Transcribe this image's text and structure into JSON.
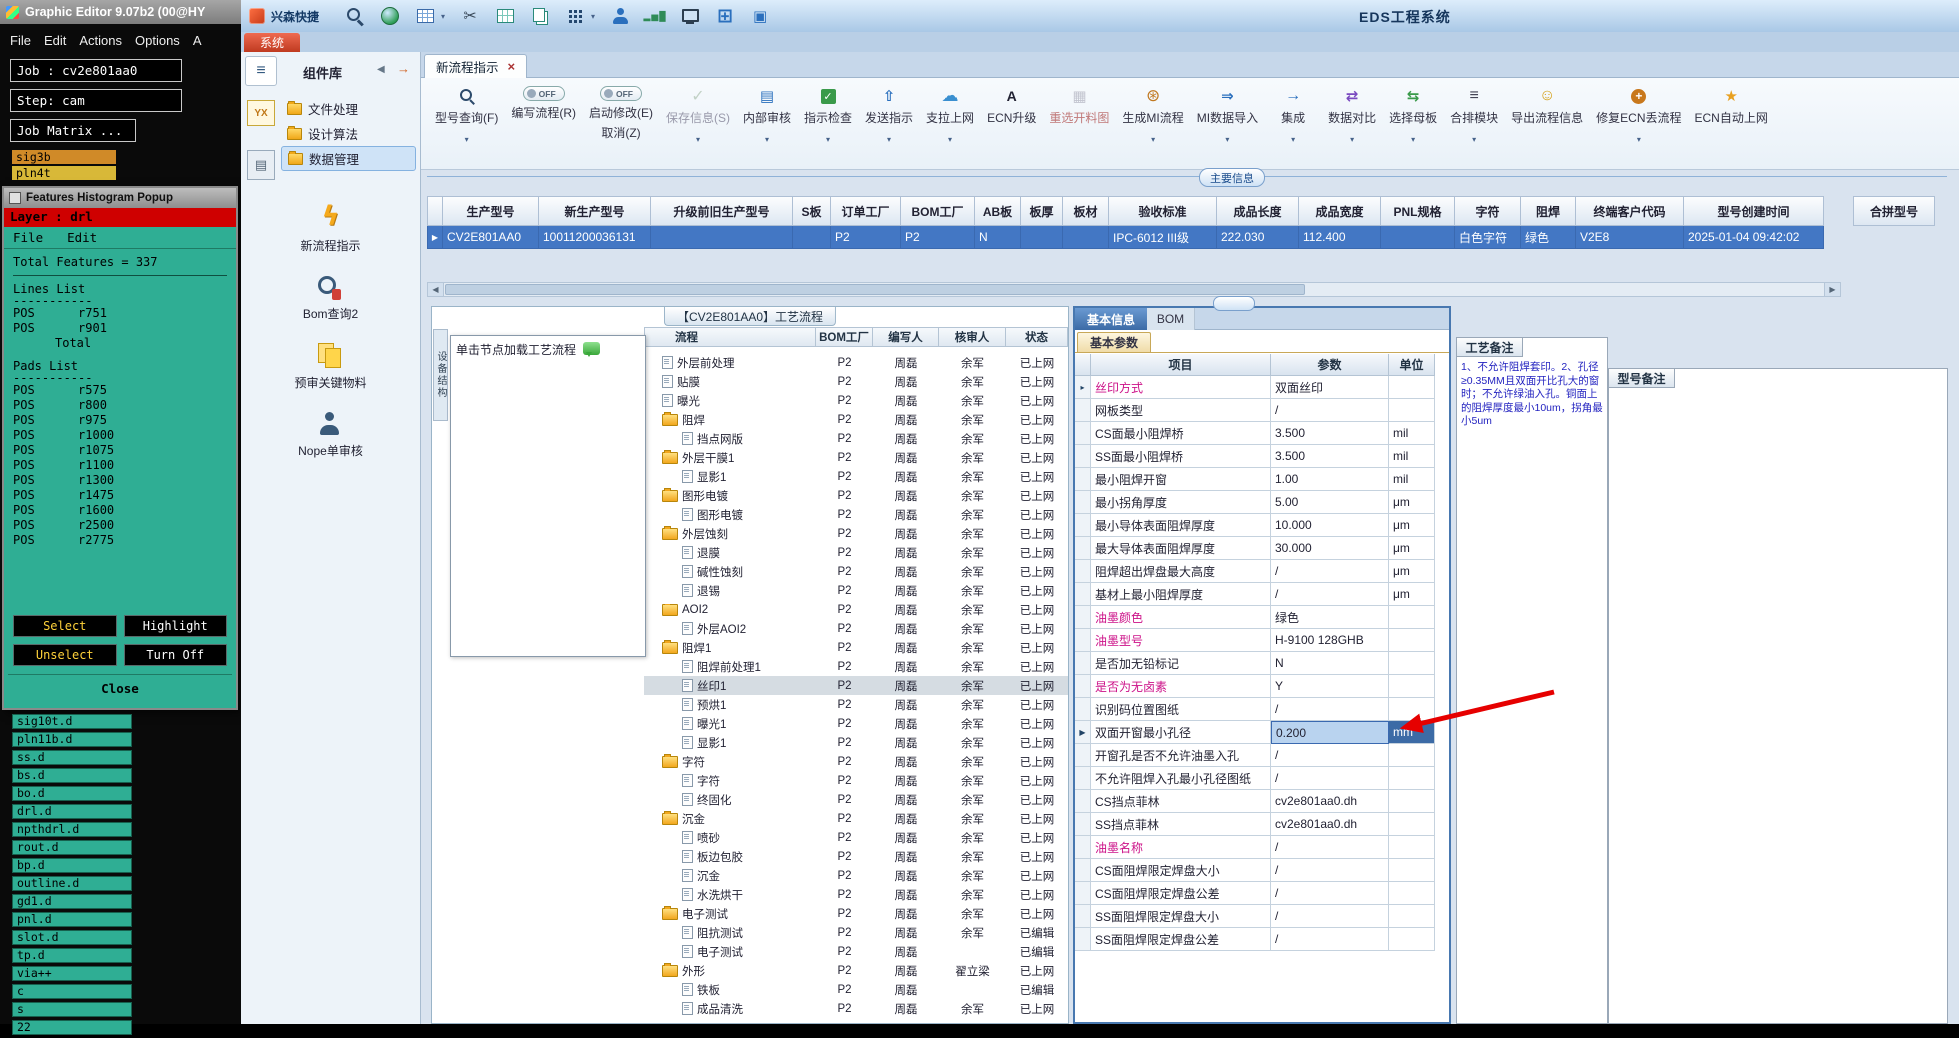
{
  "left_app": {
    "title": "Graphic Editor 9.07b2 (00@HY",
    "menus": [
      "File",
      "Edit",
      "Actions",
      "Options",
      "A"
    ],
    "job": "Job : cv2e801aa0",
    "step": "Step: cam",
    "matrix": "Job Matrix ...",
    "top_layers": [
      "sig3b",
      "pln4t"
    ],
    "hist": {
      "title": "Features Histogram Popup",
      "layer": "Layer :  drl",
      "menus": [
        "File",
        "Edit"
      ],
      "total": "Total Features = 337",
      "lines_title": "Lines List",
      "sep": "-----------",
      "lines": [
        "POS      r751",
        "POS      r901"
      ],
      "total_row": "Total",
      "pads_title": "Pads List",
      "pads": [
        "POS      r575",
        "POS      r800",
        "POS      r975",
        "POS      r1000",
        "POS      r1075",
        "POS      r1100",
        "POS      r1300",
        "POS      r1475",
        "POS      r1600",
        "POS      r2500",
        "POS      r2775"
      ],
      "btn_select": "Select",
      "btn_highlight": "Highlight",
      "btn_unselect": "Unselect",
      "btn_turnoff": "Turn Off",
      "btn_close": "Close"
    },
    "bottom_layers": [
      "sig10t.d",
      "pln11b.d",
      "ss.d",
      "bs.d",
      "bo.d",
      "drl.d",
      "npthdrl.d",
      "rout.d",
      "bp.d",
      "outline.d",
      "gd1.d",
      "pnl.d",
      "slot.d",
      "tp.d",
      "via++",
      "c",
      "s",
      "22"
    ]
  },
  "eds": {
    "topbar": {
      "quick": "兴森快捷",
      "title": "EDS工程系统",
      "icons": [
        "search-icon",
        "globe-icon",
        "table-icon",
        "scissors-icon",
        "film-icon",
        "copy-icon",
        "apps-grid-icon",
        "user-icon",
        "chart-icon",
        "monitor-icon",
        "windows-icon",
        "layers-icon"
      ]
    },
    "system_tab": "系统",
    "sidebar": {
      "title": "组件库",
      "logo": "YX",
      "menu": [
        "文件处理",
        "设计算法",
        "数据管理"
      ],
      "selected_index": 2,
      "tools": [
        "新流程指示",
        "Bom查询2",
        "预审关键物料",
        "Nope单审核"
      ]
    },
    "doc_tab": "新流程指示",
    "ribbon": [
      {
        "label": "型号查询(F)",
        "icon": "search",
        "caret": true
      },
      {
        "label": "编写流程(R)",
        "toggle": "OFF"
      },
      {
        "label": "启动修改(E)",
        "label2": "取消(Z)",
        "toggle": "OFF"
      },
      {
        "label": "保存信息(S)",
        "icon": "save",
        "disabled": true,
        "caret": true
      },
      {
        "label": "内部审核",
        "icon": "audit",
        "caret": true
      },
      {
        "label": "指示检查",
        "icon": "check",
        "caret": true
      },
      {
        "label": "发送指示",
        "icon": "send",
        "caret": true
      },
      {
        "label": "支拉上网",
        "icon": "cloud",
        "caret": true
      },
      {
        "label": "ECN升级",
        "icon": "ecn"
      },
      {
        "label": "重选开料图",
        "icon": "image",
        "disabled": true
      },
      {
        "label": "生成MI流程",
        "icon": "gear",
        "caret": true
      },
      {
        "label": "MI数据导入",
        "icon": "import",
        "caret": true
      },
      {
        "label": "集成",
        "icon": "integrate",
        "caret": true
      },
      {
        "label": "数据对比",
        "icon": "compare",
        "caret": true
      },
      {
        "label": "选择母板",
        "icon": "board",
        "caret": true
      },
      {
        "label": "合排模块",
        "icon": "list",
        "caret": true
      },
      {
        "label": "导出流程信息",
        "icon": "export"
      },
      {
        "label": "修复ECN丢流程",
        "icon": "repair",
        "caret": true
      },
      {
        "label": "ECN自动上网",
        "icon": "star"
      }
    ],
    "section_title": "主要信息",
    "main_table": {
      "headers": [
        "生产型号",
        "新生产型号",
        "升级前旧生产型号",
        "S板",
        "订单工厂",
        "BOM工厂",
        "AB板",
        "板厚",
        "板材",
        "验收标准",
        "成品长度",
        "成品宽度",
        "PNL规格",
        "字符",
        "阻焊",
        "终端客户代码",
        "型号创建时间"
      ],
      "extra_header": "合拼型号",
      "row": [
        "CV2E801AA0",
        "10011200036131",
        "",
        "",
        "P2",
        "P2",
        "N",
        "",
        "",
        "IPC-6012 III级",
        "222.030",
        "112.400",
        "",
        "白色字符",
        "绿色",
        "V2E8",
        "2025-01-04 09:42:02"
      ]
    },
    "flow": {
      "title": "【CV2E801AA0】工艺流程",
      "side_tab": "设备结构",
      "hint": "单击节点加载工艺流程",
      "headers": [
        "流程",
        "BOM工厂",
        "编写人",
        "核审人",
        "状态"
      ],
      "rows": [
        [
          "l",
          1,
          "外层前处理",
          "P2",
          "周磊",
          "余军",
          "已上网",
          0
        ],
        [
          "l",
          1,
          "贴膜",
          "P2",
          "周磊",
          "余军",
          "已上网",
          0
        ],
        [
          "l",
          1,
          "曝光",
          "P2",
          "周磊",
          "余军",
          "已上网",
          0
        ],
        [
          "f",
          1,
          "阻焊",
          "P2",
          "周磊",
          "余军",
          "已上网",
          0
        ],
        [
          "l",
          2,
          "挡点网版",
          "P2",
          "周磊",
          "余军",
          "已上网",
          0
        ],
        [
          "f",
          1,
          "外层干膜1",
          "P2",
          "周磊",
          "余军",
          "已上网",
          0
        ],
        [
          "l",
          2,
          "显影1",
          "P2",
          "周磊",
          "余军",
          "已上网",
          0
        ],
        [
          "f",
          1,
          "图形电镀",
          "P2",
          "周磊",
          "余军",
          "已上网",
          0
        ],
        [
          "l",
          2,
          "图形电镀",
          "P2",
          "周磊",
          "余军",
          "已上网",
          0
        ],
        [
          "f",
          1,
          "外层蚀刻",
          "P2",
          "周磊",
          "余军",
          "已上网",
          0
        ],
        [
          "l",
          2,
          "退膜",
          "P2",
          "周磊",
          "余军",
          "已上网",
          0
        ],
        [
          "l",
          2,
          "碱性蚀刻",
          "P2",
          "周磊",
          "余军",
          "已上网",
          0
        ],
        [
          "l",
          2,
          "退锡",
          "P2",
          "周磊",
          "余军",
          "已上网",
          0
        ],
        [
          "f",
          1,
          "AOI2",
          "P2",
          "周磊",
          "余军",
          "已上网",
          0
        ],
        [
          "l",
          2,
          "外层AOI2",
          "P2",
          "周磊",
          "余军",
          "已上网",
          0
        ],
        [
          "f",
          1,
          "阻焊1",
          "P2",
          "周磊",
          "余军",
          "已上网",
          0
        ],
        [
          "l",
          2,
          "阻焊前处理1",
          "P2",
          "周磊",
          "余军",
          "已上网",
          0
        ],
        [
          "l",
          2,
          "丝印1",
          "P2",
          "周磊",
          "余军",
          "已上网",
          1
        ],
        [
          "l",
          2,
          "预烘1",
          "P2",
          "周磊",
          "余军",
          "已上网",
          0
        ],
        [
          "l",
          2,
          "曝光1",
          "P2",
          "周磊",
          "余军",
          "已上网",
          0
        ],
        [
          "l",
          2,
          "显影1",
          "P2",
          "周磊",
          "余军",
          "已上网",
          0
        ],
        [
          "f",
          1,
          "字符",
          "P2",
          "周磊",
          "余军",
          "已上网",
          0
        ],
        [
          "l",
          2,
          "字符",
          "P2",
          "周磊",
          "余军",
          "已上网",
          0
        ],
        [
          "l",
          2,
          "终固化",
          "P2",
          "周磊",
          "余军",
          "已上网",
          0
        ],
        [
          "f",
          1,
          "沉金",
          "P2",
          "周磊",
          "余军",
          "已上网",
          0
        ],
        [
          "l",
          2,
          "喷砂",
          "P2",
          "周磊",
          "余军",
          "已上网",
          0
        ],
        [
          "l",
          2,
          "板边包胶",
          "P2",
          "周磊",
          "余军",
          "已上网",
          0
        ],
        [
          "l",
          2,
          "沉金",
          "P2",
          "周磊",
          "余军",
          "已上网",
          0
        ],
        [
          "l",
          2,
          "水洗烘干",
          "P2",
          "周磊",
          "余军",
          "已上网",
          0
        ],
        [
          "f",
          1,
          "电子测试",
          "P2",
          "周磊",
          "余军",
          "已上网",
          0
        ],
        [
          "l",
          2,
          "阻抗测试",
          "P2",
          "周磊",
          "余军",
          "已编辑",
          0
        ],
        [
          "l",
          2,
          "电子测试",
          "P2",
          "周磊",
          "",
          "已编辑",
          0
        ],
        [
          "f",
          1,
          "外形",
          "P2",
          "周磊",
          "翟立梁",
          "已上网",
          0
        ],
        [
          "l",
          2,
          "铁板",
          "P2",
          "周磊",
          "",
          "已编辑",
          0
        ],
        [
          "l",
          2,
          "成品清洗",
          "P2",
          "周磊",
          "余军",
          "已上网",
          0
        ]
      ]
    },
    "params": {
      "tab_active": "基本信息",
      "tab_bom": "BOM",
      "sub_tab": "基本参数",
      "headers": [
        "项目",
        "参数",
        "单位"
      ],
      "rows": [
        [
          "丝印方式",
          "双面丝印",
          "",
          "p"
        ],
        [
          "网板类型",
          "/",
          "",
          ""
        ],
        [
          "CS面最小阻焊桥",
          "3.500",
          "mil",
          ""
        ],
        [
          "SS面最小阻焊桥",
          "3.500",
          "mil",
          ""
        ],
        [
          "最小阻焊开窗",
          "1.00",
          "mil",
          ""
        ],
        [
          "最小拐角厚度",
          "5.00",
          "μm",
          ""
        ],
        [
          "最小导体表面阻焊厚度",
          "10.000",
          "μm",
          ""
        ],
        [
          "最大导体表面阻焊厚度",
          "30.000",
          "μm",
          ""
        ],
        [
          "阻焊超出焊盘最大高度",
          "/",
          "μm",
          ""
        ],
        [
          "基材上最小阻焊厚度",
          "/",
          "μm",
          ""
        ],
        [
          "油墨颜色",
          "绿色",
          "",
          "p"
        ],
        [
          "油墨型号",
          "H-9100 128GHB",
          "",
          "p"
        ],
        [
          "是否加无铅标记",
          "N",
          "",
          ""
        ],
        [
          "是否为无卤素",
          "Y",
          "",
          "p"
        ],
        [
          "识别码位置图纸",
          "/",
          "",
          ""
        ],
        [
          "双面开窗最小孔径",
          "0.200",
          "mm",
          "s"
        ],
        [
          "开窗孔是否不允许油墨入孔",
          "/",
          "",
          ""
        ],
        [
          "不允许阻焊入孔最小孔径图纸",
          "/",
          "",
          ""
        ],
        [
          "CS挡点菲林",
          "cv2e801aa0.dh",
          "",
          ""
        ],
        [
          "SS挡点菲林",
          "cv2e801aa0.dh",
          "",
          ""
        ],
        [
          "油墨名称",
          "/",
          "",
          "p"
        ],
        [
          "CS面阻焊限定焊盘大小",
          "/",
          "",
          ""
        ],
        [
          "CS面阻焊限定焊盘公差",
          "/",
          "",
          ""
        ],
        [
          "SS面阻焊限定焊盘大小",
          "/",
          "",
          ""
        ],
        [
          "SS面阻焊限定焊盘公差",
          "/",
          "",
          ""
        ]
      ]
    },
    "notes": {
      "process_title": "工艺备注",
      "process_text": "1、不允许阻焊套印。2、孔径≥0.35MM且双面开比孔大的窗时；不允许绿油入孔。铜面上的阻焊厚度最小10um，拐角最小5um",
      "model_title": "型号备注"
    }
  }
}
